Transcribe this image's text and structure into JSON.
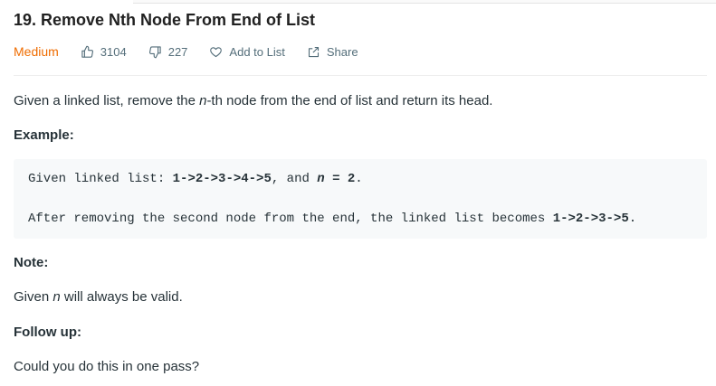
{
  "problem": {
    "title": "19. Remove Nth Node From End of List",
    "difficulty": "Medium",
    "likes": "3104",
    "dislikes": "227",
    "add_to_list_label": "Add to List",
    "share_label": "Share"
  },
  "description": {
    "part1": "Given a linked list, remove the ",
    "n_var": "n",
    "part2": "-th node from the end of list and return its head."
  },
  "example": {
    "label": "Example:",
    "line1_prefix": "Given linked list: ",
    "line1_list": "1->2->3->4->5",
    "line1_mid": ", and ",
    "line1_n": "n",
    "line1_eq": " = 2",
    "line1_end": ".",
    "line2_prefix": "After removing the second node from the end, the linked list becomes ",
    "line2_list": "1->2->3->5",
    "line2_end": "."
  },
  "note": {
    "label": "Note:",
    "text_prefix": "Given ",
    "n_var": "n",
    "text_suffix": " will always be valid."
  },
  "follow_up": {
    "label": "Follow up:",
    "text": "Could you do this in one pass?"
  },
  "colors": {
    "difficulty_medium": "#ef6c00",
    "meta_text": "#546e7a",
    "code_background": "#f7f9fa"
  },
  "icons": [
    "thumbs-up-icon",
    "thumbs-down-icon",
    "heart-icon",
    "share-icon"
  ]
}
